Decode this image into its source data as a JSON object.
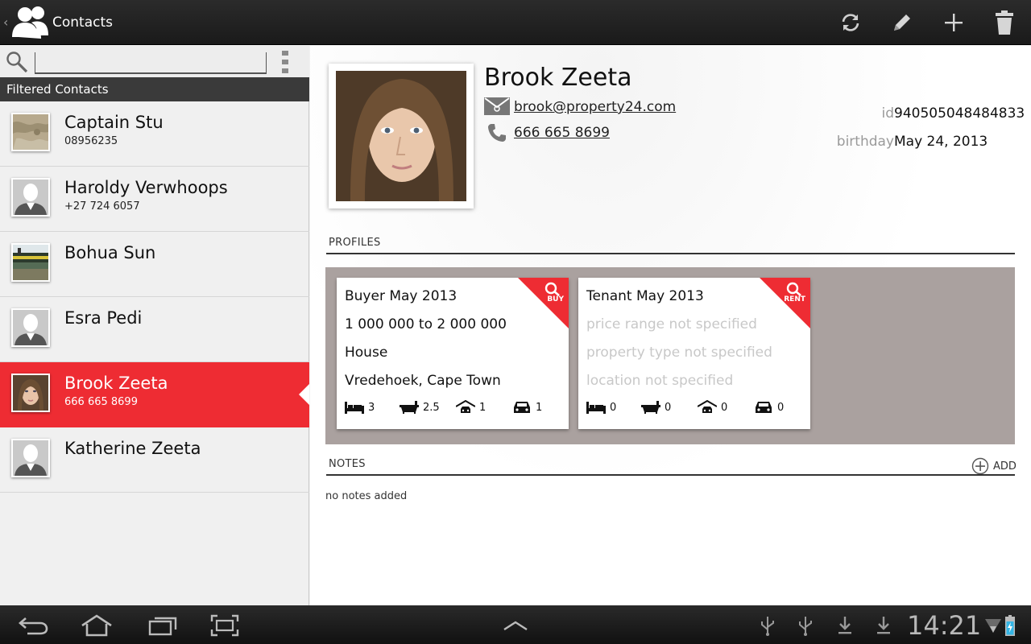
{
  "app": {
    "title": "Contacts",
    "up_glyph": "‹"
  },
  "colors": {
    "accent": "#ee2c33",
    "actionbar": "#222222",
    "profiles_bg": "#aaa19f"
  },
  "actions": [
    {
      "name": "refresh-button",
      "icon": "refresh-icon"
    },
    {
      "name": "edit-button",
      "icon": "pencil-icon"
    },
    {
      "name": "add-button",
      "icon": "plus-icon"
    },
    {
      "name": "delete-button",
      "icon": "trash-icon"
    }
  ],
  "search": {
    "placeholder": "",
    "value": ""
  },
  "list": {
    "header": "Filtered Contacts",
    "contacts": [
      {
        "name": "Captain Stu",
        "phone": "08956235",
        "avatar": "photo-map"
      },
      {
        "name": "Haroldy Verwhoops",
        "phone": "+27 724 6057",
        "avatar": "silhouette"
      },
      {
        "name": "Bohua Sun",
        "phone": "",
        "avatar": "photo-boat"
      },
      {
        "name": "Esra Pedi",
        "phone": "",
        "avatar": "silhouette"
      },
      {
        "name": "Brook Zeeta",
        "phone": "666 665 8699",
        "avatar": "photo-face",
        "selected": true
      },
      {
        "name": "Katherine Zeeta",
        "phone": "",
        "avatar": "silhouette"
      }
    ]
  },
  "detail": {
    "name": "Brook Zeeta",
    "email": "brook@property24.com",
    "phone": "666 665 8699",
    "id_label": "id",
    "id_value": "940505048484833",
    "birthday_label": "birthday",
    "birthday_value": "May 24, 2013"
  },
  "profiles": {
    "label": "PROFILES",
    "cards": [
      {
        "title": "Buyer May 2013",
        "price": "1 000 000 to 2 000 000",
        "type": "House",
        "location": "Vredehoek, Cape Town",
        "badge": "BUY",
        "stats": {
          "beds": "3",
          "baths": "2.5",
          "garages": "1",
          "parking": "1"
        }
      },
      {
        "title": "Tenant May 2013",
        "price": "price range not specified",
        "type": "property type not specified",
        "location": "location not specified",
        "badge": "RENT",
        "stats": {
          "beds": "0",
          "baths": "0",
          "garages": "0",
          "parking": "0"
        }
      }
    ]
  },
  "notes": {
    "label": "NOTES",
    "add_label": "ADD",
    "empty": "no notes added"
  },
  "status": {
    "time": "14:21"
  }
}
